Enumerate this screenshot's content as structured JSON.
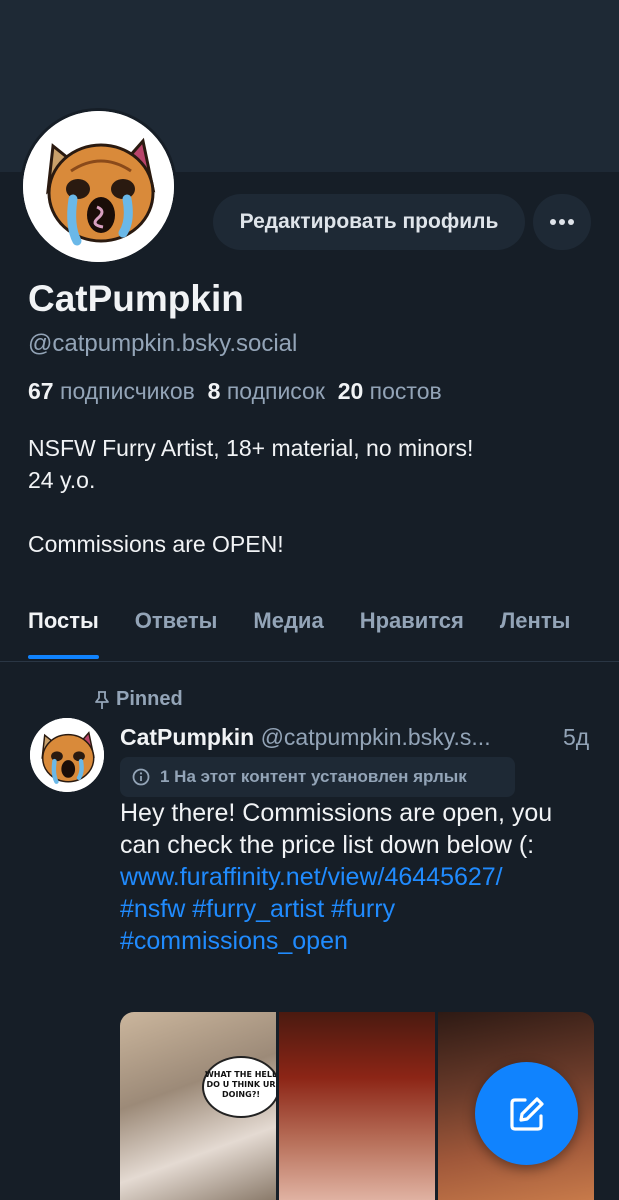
{
  "profile": {
    "display_name": "CatPumpkin",
    "handle": "@catpumpkin.bsky.social",
    "edit_button": "Редактировать профиль",
    "more_icon": "ellipsis-icon",
    "stats": {
      "followers_count": "67",
      "followers_label": "подписчиков",
      "following_count": "8",
      "following_label": "подписок",
      "posts_count": "20",
      "posts_label": "постов"
    },
    "bio": "NSFW Furry Artist, 18+ material, no minors!\n24 y.o.\n\nCommissions are OPEN!"
  },
  "tabs": [
    {
      "label": "Посты",
      "active": true
    },
    {
      "label": "Ответы",
      "active": false
    },
    {
      "label": "Медиа",
      "active": false
    },
    {
      "label": "Нравится",
      "active": false
    },
    {
      "label": "Ленты",
      "active": false
    }
  ],
  "post": {
    "pinned_label": "Pinned",
    "author_name": "CatPumpkin",
    "author_handle": "@catpumpkin.bsky.s...",
    "time": "5д",
    "content_label": "1 На этот контент установлен ярлык",
    "text": "Hey there! Commissions are open, you can check the price list down below (:",
    "link": "www.furaffinity.net/view/46445627/",
    "hashtags": "#nsfw #furry_artist #furry #commissions_open",
    "speech_bubble": "WHAT THE HELL DO U THINK UR DOING?!"
  },
  "fab": {
    "icon": "compose-icon"
  },
  "colors": {
    "background": "#161e27",
    "banner": "#1e2935",
    "accent": "#1083fe",
    "link": "#208bfe",
    "muted_text": "#93a4b7"
  }
}
